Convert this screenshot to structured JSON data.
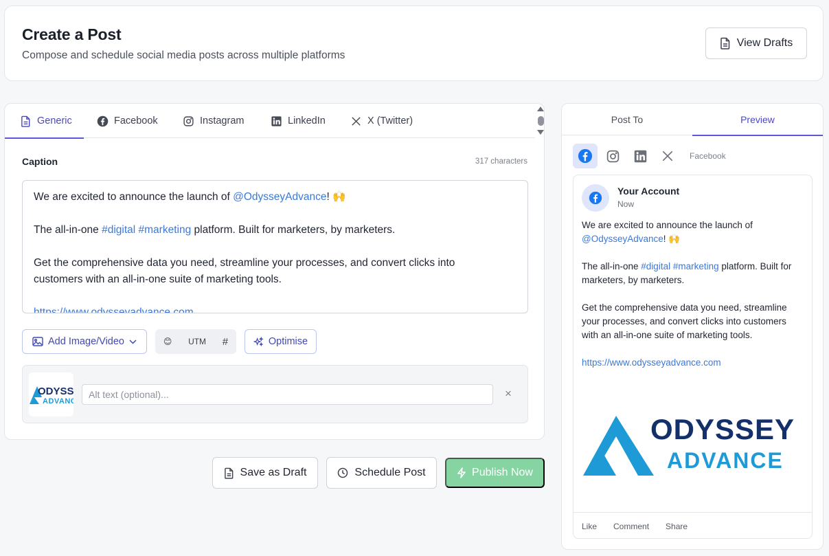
{
  "header": {
    "title": "Create a Post",
    "subtitle": "Compose and schedule social media posts across multiple platforms",
    "view_drafts_label": "View Drafts"
  },
  "editor": {
    "tabs": [
      {
        "label": "Generic",
        "icon": "document-icon",
        "active": true
      },
      {
        "label": "Facebook",
        "icon": "facebook-icon",
        "active": false
      },
      {
        "label": "Instagram",
        "icon": "instagram-icon",
        "active": false
      },
      {
        "label": "LinkedIn",
        "icon": "linkedin-icon",
        "active": false
      },
      {
        "label": "X (Twitter)",
        "icon": "x-icon",
        "active": false
      }
    ],
    "caption_label": "Caption",
    "char_count": "317 characters",
    "caption": {
      "line1_pre": "We are excited to announce the launch of ",
      "line1_mention": "@OdysseyAdvance",
      "line1_post": "! 🙌",
      "line2_pre": "The all-in-one ",
      "line2_tag1": "#digital",
      "line2_space": " ",
      "line2_tag2": "#marketing",
      "line2_post": " platform. Built for marketers, by marketers.",
      "line3a": "Get the comprehensive data you need, streamline your processes, and convert clicks into",
      "line3b": "customers with an all-in-one suite of marketing tools.",
      "url": "https://www.odysseyadvance.com"
    },
    "toolbar": {
      "add_media_label": "Add Image/Video",
      "emoji": "😊",
      "utm_label": "UTM",
      "hash_label": "#",
      "optimise_label": "Optimise"
    },
    "media": {
      "alt_placeholder": "Alt text (optional)...",
      "logo_line1": "ODYSSEY",
      "logo_line2": "ADVANCE",
      "remove_label": "×"
    }
  },
  "actions": {
    "save_draft_label": "Save as Draft",
    "schedule_label": "Schedule Post",
    "publish_label": "Publish Now"
  },
  "sidebar": {
    "tabs": [
      {
        "label": "Post To",
        "active": false
      },
      {
        "label": "Preview",
        "active": true
      }
    ],
    "platforms": [
      "facebook-icon",
      "instagram-icon",
      "linkedin-icon",
      "x-icon"
    ],
    "selected_platform_label": "Facebook",
    "preview": {
      "account_name": "Your Account",
      "time": "Now",
      "p1_pre": "We are excited to announce the launch of",
      "p1_mention": "@OdysseyAdvance",
      "p1_post": "! 🙌",
      "p2_pre": "The all-in-one ",
      "p2_tag1": "#digital",
      "p2_space": " ",
      "p2_tag2": "#marketing",
      "p2_post": " platform. Built for marketers, by marketers.",
      "p3": "Get the comprehensive data you need, streamline your processes, and convert clicks into customers with an all-in-one suite of marketing tools.",
      "url": "https://www.odysseyadvance.com",
      "logo_line1": "ODYSSEY",
      "logo_line2": "ADVANCE",
      "like_label": "Like",
      "comment_label": "Comment",
      "share_label": "Share"
    }
  },
  "colors": {
    "accent": "#5b57d6",
    "link": "#3b79d8",
    "facebook": "#1877f2",
    "publish": "#86d4a2",
    "logo_blue": "#1e9ad6",
    "logo_navy": "#14306b"
  }
}
